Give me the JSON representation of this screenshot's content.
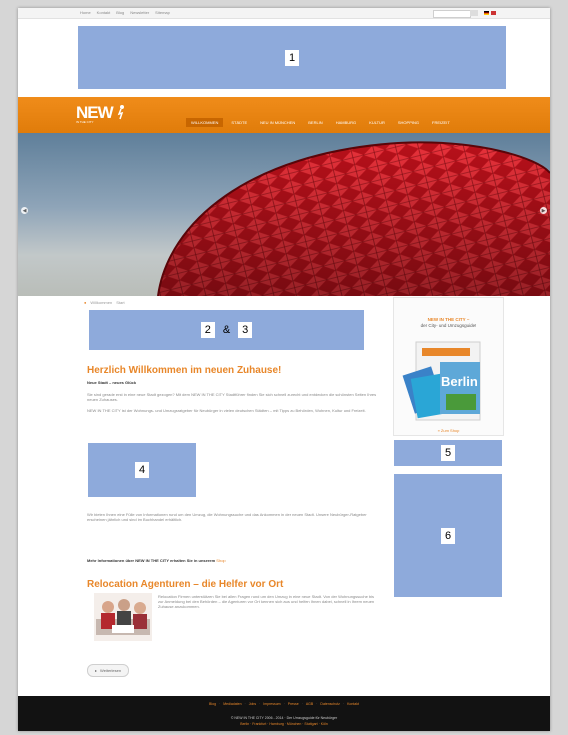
{
  "topbar": {
    "links": [
      "Home",
      "Kontakt",
      "Blog",
      "Newsletter",
      "Sitemap"
    ]
  },
  "placeholders": {
    "p1": "1",
    "p2": "2",
    "p3": "3",
    "amp": "&",
    "p4": "4",
    "p5": "5",
    "p6": "6"
  },
  "header": {
    "logo": "NEW",
    "logo_sub": "IN THE CITY",
    "nav": [
      "Willkommen",
      "Städte",
      "Neu in München",
      "Berlin",
      "Hamburg",
      "Kultur",
      "Shopping",
      "Freizeit"
    ]
  },
  "breadcrumb": [
    "Willkommen",
    "Start"
  ],
  "main": {
    "headline": "Herzlich Willkommen im neuen Zuhause!",
    "intro": "Neue Stadt – neues Glück",
    "p1": "Sie sind gerade erst in eine neue Stadt gezogen? Mit dem NEW IN THE CITY Stadtführer finden Sie sich schnell zurecht und entdecken die schönsten Seiten Ihres neuen Zuhauses.",
    "p2": "NEW IN THE CITY ist der Wohnungs- und Umzugsratgeber für Neubürger in vielen deutschen Städten – mit Tipps zu Behörden, Wohnen, Kultur und Freizeit.",
    "p3": "Wir bieten Ihnen eine Fülle von Informationen rund um den Umzug, die Wohnungssuche und das Ankommen in der neuen Stadt. Unsere Neubürger-Ratgeber erscheinen jährlich und sind im Buchhandel erhältlich.",
    "info_prefix": "Mehr Informationen über NEW IN THE CITY erhalten Sie in unserem",
    "info_link": "Shop",
    "headline2": "Relocation Agenturen – die Helfer vor Ort",
    "p4": "Relocation Firmen unterstützen Sie bei allen Fragen rund um den Umzug in eine neue Stadt. Von der Wohnungssuche bis zur Anmeldung bei den Behörden – die Agenturen vor Ort kennen sich aus und helfen Ihnen dabei, schnell in Ihrem neuen Zuhause anzukommen.",
    "more": "Weiterlesen"
  },
  "sidebar": {
    "book_title_1": "NEW IN THE CITY –",
    "book_title_2": "der City- und Umzugsguide!",
    "book_city": "Berlin",
    "book_link": "» Zum Shop"
  },
  "footer": {
    "links": [
      "Blog",
      "Mediadaten",
      "Jobs",
      "Impressum",
      "Presse",
      "AGB",
      "Datenschutz",
      "Kontakt"
    ],
    "copyright": "© NEW IN THE CITY 2006 - 2014 · Der Umzugsguide für Neubürger",
    "cities": "Berlin · Frankfurt · Hamburg · München · Stuttgart · Köln"
  },
  "colors": {
    "accent": "#e8872a",
    "placeholder": "#8eaadb",
    "footer": "#121212"
  }
}
